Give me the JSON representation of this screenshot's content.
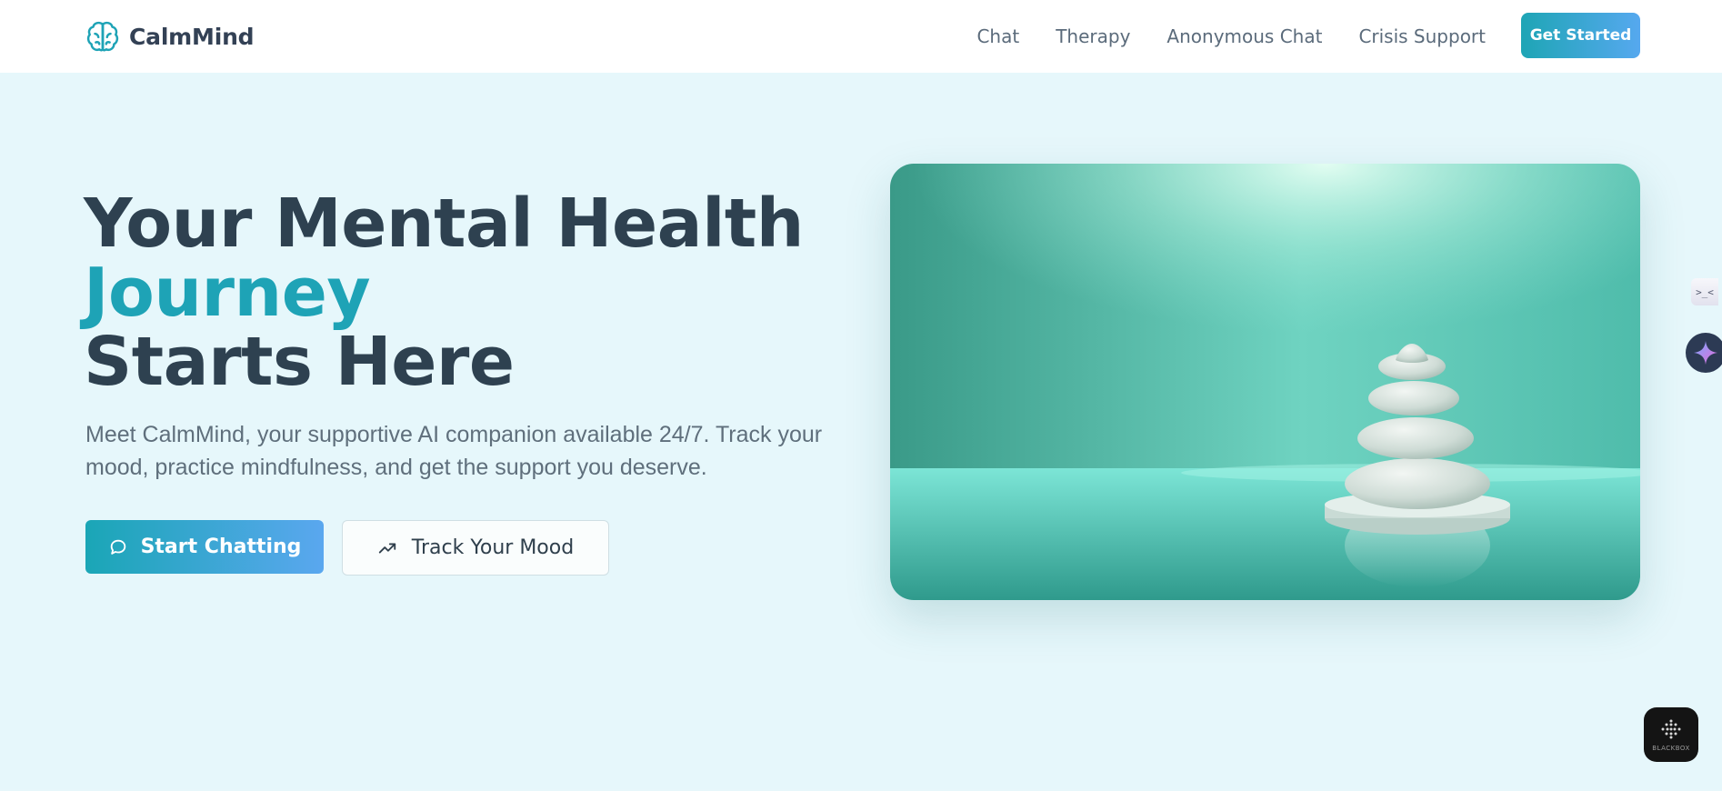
{
  "navbar": {
    "brand_name": "CalmMind",
    "brand_icon": "brain-icon",
    "links": [
      {
        "label": "Chat"
      },
      {
        "label": "Therapy"
      },
      {
        "label": "Anonymous Chat"
      },
      {
        "label": "Crisis Support"
      }
    ],
    "cta_label": "Get Started"
  },
  "hero": {
    "headline_line1": "Your Mental Health",
    "headline_accent": "Journey",
    "headline_line3": "Starts Here",
    "subtitle": "Meet CalmMind, your supportive AI companion available 24/7. Track your mood, practice mindfulness, and get the support you deserve.",
    "primary_button": {
      "label": "Start Chatting",
      "icon": "chat-bubble-icon"
    },
    "secondary_button": {
      "label": "Track Your Mood",
      "icon": "trending-up-icon"
    },
    "image": "stacked-zen-stones-image"
  },
  "overlays": {
    "side_tab_text": ">_<",
    "ai_button_icon": "sparkle-icon",
    "blackbox_label": "BLACKBOX"
  },
  "colors": {
    "accent": "#1ea3b6",
    "heading": "#2e4150",
    "body_text": "#5f6f7c",
    "background": "#e6f7fb",
    "gradient_start": "#1aa6b6",
    "gradient_end": "#5aa7ef"
  }
}
